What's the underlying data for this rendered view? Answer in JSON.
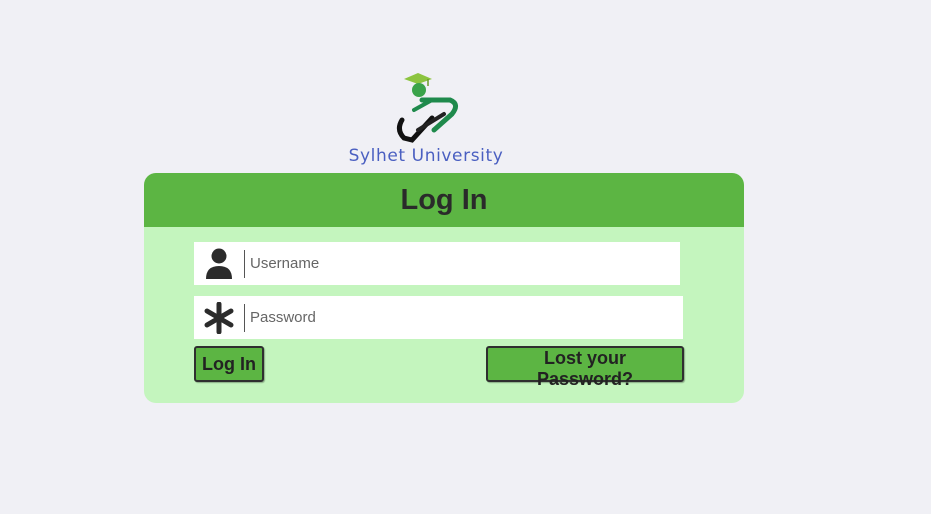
{
  "brand": {
    "name": "Sylhet University",
    "colors": {
      "logo_text": "#4a5fc1",
      "logo_green": "#1f8a4c",
      "cap_green": "#8cc43f"
    }
  },
  "login": {
    "title": "Log In",
    "username_placeholder": "Username",
    "password_placeholder": "Password",
    "login_button": "Log In",
    "lost_password_button": "Lost your Password?",
    "icons": {
      "username": "user-icon",
      "password": "asterisk-icon"
    }
  },
  "colors": {
    "page_bg": "#f0f0f5",
    "card_bg": "#c4f5be",
    "header_bg": "#5cb543",
    "button_bg": "#5cb543"
  }
}
